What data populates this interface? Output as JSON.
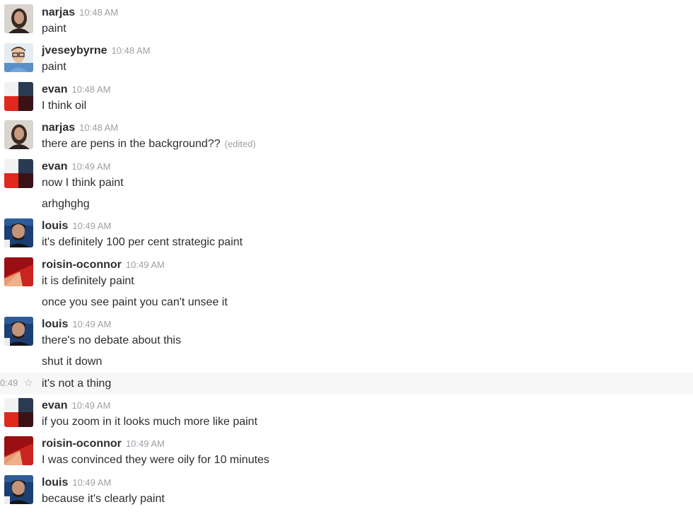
{
  "messages": [
    {
      "user": "narjas",
      "time": "10:48 AM",
      "lines": [
        "paint"
      ]
    },
    {
      "user": "jveseybyrne",
      "time": "10:48 AM",
      "lines": [
        "paint"
      ]
    },
    {
      "user": "evan",
      "time": "10:48 AM",
      "lines": [
        "I think oil"
      ]
    },
    {
      "user": "narjas",
      "time": "10:48 AM",
      "lines": [
        "there are pens in the background??"
      ],
      "edited": "(edited)"
    },
    {
      "user": "evan",
      "time": "10:49 AM",
      "lines": [
        "now I think paint",
        "arhghghg"
      ]
    },
    {
      "user": "louis",
      "time": "10:49 AM",
      "lines": [
        "it's definitely 100 per cent strategic paint"
      ]
    },
    {
      "user": "roisin-oconnor",
      "time": "10:49 AM",
      "lines": [
        "it is definitely paint",
        "once you see paint you can't unsee it"
      ]
    },
    {
      "user": "louis",
      "time": "10:49 AM",
      "lines": [
        "there's no debate about this",
        "shut it down",
        "it's not a thing"
      ]
    },
    {
      "user": "evan",
      "time": "10:49 AM",
      "lines": [
        "if you zoom in it looks much more like paint"
      ]
    },
    {
      "user": "roisin-oconnor",
      "time": "10:49 AM",
      "lines": [
        "I was convinced they were oily for 10 minutes"
      ]
    },
    {
      "user": "louis",
      "time": "10:49 AM",
      "lines": [
        "because it's clearly paint"
      ]
    }
  ],
  "hover_row": {
    "time": "0:49",
    "star_icon": "star-icon"
  },
  "avatars": {
    "narjas": "woman-portrait-avatar",
    "jveseybyrne": "man-glasses-avatar",
    "evan": "red-navy-blocks-avatar",
    "louis": "man-dark-hair-avatar",
    "roisin-oconnor": "red-diagonal-avatar"
  }
}
